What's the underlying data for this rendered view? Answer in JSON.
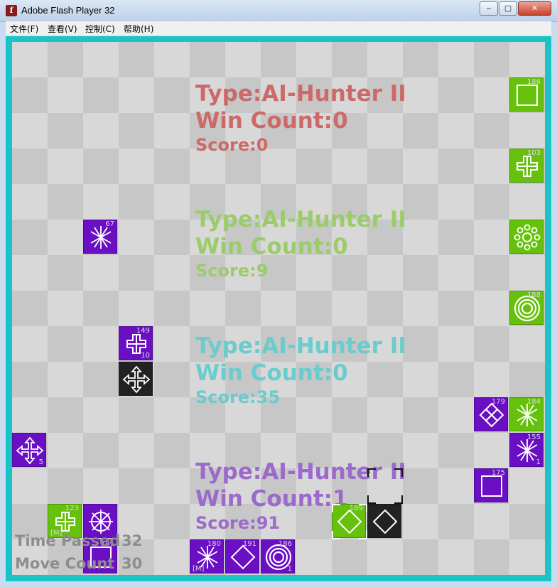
{
  "window": {
    "title": "Adobe Flash Player 32",
    "min": "‒",
    "max": "▢",
    "close": "✕",
    "icon_label": "f"
  },
  "menu": [
    "文件(F)",
    "查看(V)",
    "控制(C)",
    "帮助(H)"
  ],
  "players": [
    {
      "type_label": "Type:",
      "type": "AI-Hunter II",
      "win_label": "Win Count:",
      "win": "0",
      "score_label": "Score:",
      "score": "0",
      "color": "#cc6a6a"
    },
    {
      "type_label": "Type:",
      "type": "AI-Hunter II",
      "win_label": "Win Count:",
      "win": "0",
      "score_label": "Score:",
      "score": "9",
      "color": "#9ccc6a"
    },
    {
      "type_label": "Type:",
      "type": "AI-Hunter II",
      "win_label": "Win Count:",
      "win": "0",
      "score_label": "Score:",
      "score": "35",
      "color": "#6acccc"
    },
    {
      "type_label": "Type:",
      "type": "AI-Hunter II",
      "win_label": "Win Count:",
      "win": "1",
      "score_label": "Score:",
      "score": "91",
      "color": "#9b6acc"
    }
  ],
  "stats": {
    "time_label": "Time Passed",
    "time_value": "32",
    "move_label": "Move Count",
    "move_value": "30"
  },
  "tiles": {
    "t_green_square": {
      "num": "186"
    },
    "t_green_cross": {
      "num": "103"
    },
    "t_purple_star": {
      "num": "67"
    },
    "t_green_circle": {
      "num": "188"
    },
    "t_purple_plus": {
      "num": "149",
      "sub": "10"
    },
    "t_purple_lattice": {
      "num": "179"
    },
    "t_green_star": {
      "num": "184"
    },
    "t_purple_star2": {
      "num": "155",
      "sub": "1"
    },
    "t_purple_arrows": {
      "sub": "5"
    },
    "t_purple_square": {
      "num": "175"
    },
    "t_green_plus2": {
      "num": "123",
      "subl": "[M]"
    },
    "t_purple_square2": {
      "num": "191"
    },
    "t_purple_star3": {
      "num": "180",
      "subl": "[M]"
    },
    "t_purple_diamond": {
      "num": "191"
    },
    "t_purple_rings": {
      "num": "186",
      "sub": "1"
    },
    "t_green_diamond": {
      "num": "189"
    }
  }
}
